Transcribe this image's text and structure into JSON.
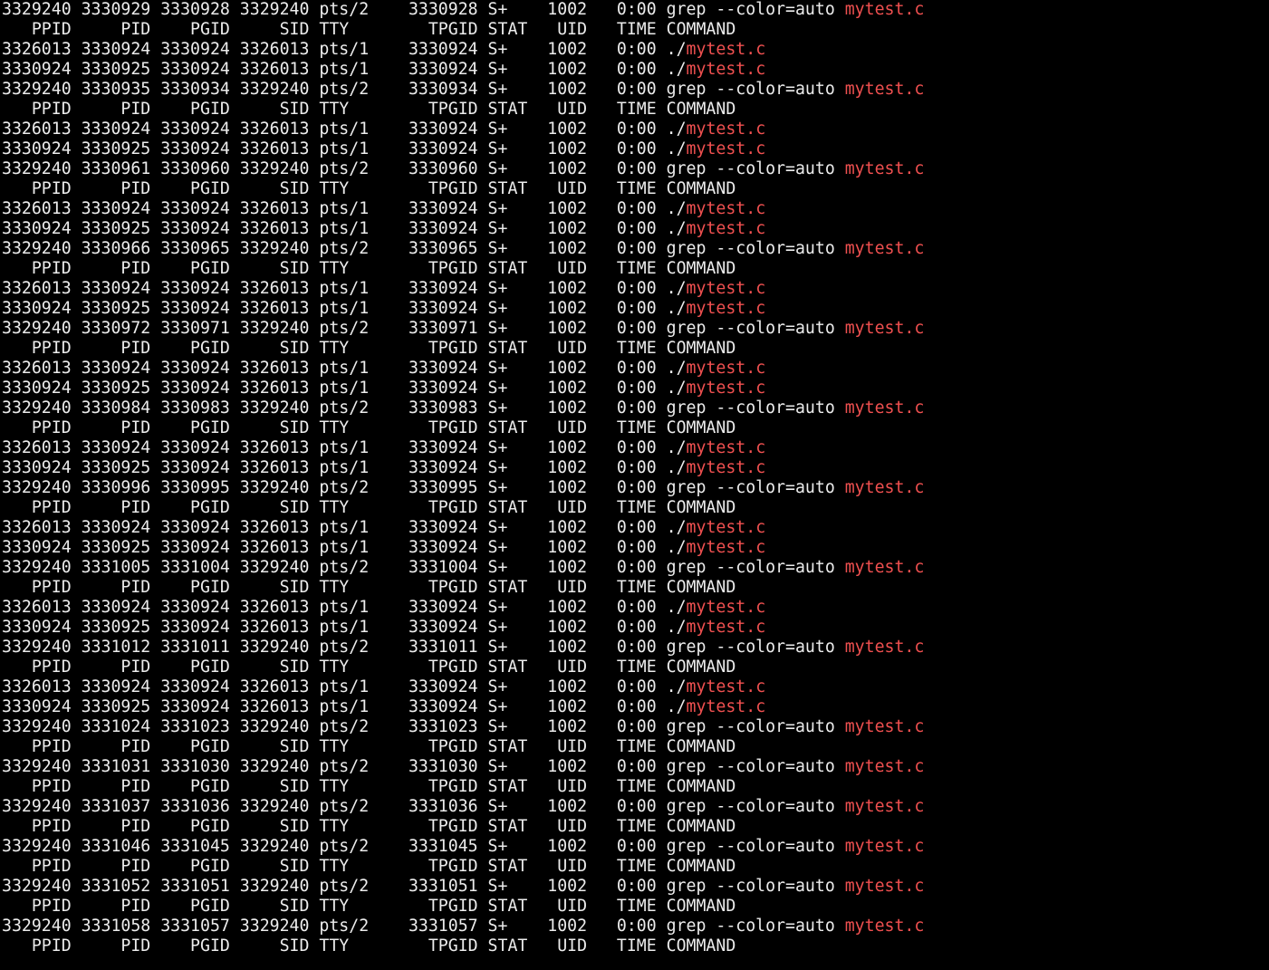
{
  "terminal": {
    "colors": {
      "background": "#000000",
      "foreground": "#ececec",
      "match_highlight": "#f05050"
    },
    "lines": [
      {
        "pre": "3329240 3330929 3330928 3329240 pts/2    3330928 S+    1002   0:00 grep --color=auto ",
        "match": "mytest.c"
      },
      {
        "pre": "   PPID     PID    PGID     SID TTY        TPGID STAT   UID   TIME COMMAND",
        "match": ""
      },
      {
        "pre": "3326013 3330924 3330924 3326013 pts/1    3330924 S+    1002   0:00 ./",
        "match": "mytest.c"
      },
      {
        "pre": "3330924 3330925 3330924 3326013 pts/1    3330924 S+    1002   0:00 ./",
        "match": "mytest.c"
      },
      {
        "pre": "3329240 3330935 3330934 3329240 pts/2    3330934 S+    1002   0:00 grep --color=auto ",
        "match": "mytest.c"
      },
      {
        "pre": "   PPID     PID    PGID     SID TTY        TPGID STAT   UID   TIME COMMAND",
        "match": ""
      },
      {
        "pre": "3326013 3330924 3330924 3326013 pts/1    3330924 S+    1002   0:00 ./",
        "match": "mytest.c"
      },
      {
        "pre": "3330924 3330925 3330924 3326013 pts/1    3330924 S+    1002   0:00 ./",
        "match": "mytest.c"
      },
      {
        "pre": "3329240 3330961 3330960 3329240 pts/2    3330960 S+    1002   0:00 grep --color=auto ",
        "match": "mytest.c"
      },
      {
        "pre": "   PPID     PID    PGID     SID TTY        TPGID STAT   UID   TIME COMMAND",
        "match": ""
      },
      {
        "pre": "3326013 3330924 3330924 3326013 pts/1    3330924 S+    1002   0:00 ./",
        "match": "mytest.c"
      },
      {
        "pre": "3330924 3330925 3330924 3326013 pts/1    3330924 S+    1002   0:00 ./",
        "match": "mytest.c"
      },
      {
        "pre": "3329240 3330966 3330965 3329240 pts/2    3330965 S+    1002   0:00 grep --color=auto ",
        "match": "mytest.c"
      },
      {
        "pre": "   PPID     PID    PGID     SID TTY        TPGID STAT   UID   TIME COMMAND",
        "match": ""
      },
      {
        "pre": "3326013 3330924 3330924 3326013 pts/1    3330924 S+    1002   0:00 ./",
        "match": "mytest.c"
      },
      {
        "pre": "3330924 3330925 3330924 3326013 pts/1    3330924 S+    1002   0:00 ./",
        "match": "mytest.c"
      },
      {
        "pre": "3329240 3330972 3330971 3329240 pts/2    3330971 S+    1002   0:00 grep --color=auto ",
        "match": "mytest.c"
      },
      {
        "pre": "   PPID     PID    PGID     SID TTY        TPGID STAT   UID   TIME COMMAND",
        "match": ""
      },
      {
        "pre": "3326013 3330924 3330924 3326013 pts/1    3330924 S+    1002   0:00 ./",
        "match": "mytest.c"
      },
      {
        "pre": "3330924 3330925 3330924 3326013 pts/1    3330924 S+    1002   0:00 ./",
        "match": "mytest.c"
      },
      {
        "pre": "3329240 3330984 3330983 3329240 pts/2    3330983 S+    1002   0:00 grep --color=auto ",
        "match": "mytest.c"
      },
      {
        "pre": "   PPID     PID    PGID     SID TTY        TPGID STAT   UID   TIME COMMAND",
        "match": ""
      },
      {
        "pre": "3326013 3330924 3330924 3326013 pts/1    3330924 S+    1002   0:00 ./",
        "match": "mytest.c"
      },
      {
        "pre": "3330924 3330925 3330924 3326013 pts/1    3330924 S+    1002   0:00 ./",
        "match": "mytest.c"
      },
      {
        "pre": "3329240 3330996 3330995 3329240 pts/2    3330995 S+    1002   0:00 grep --color=auto ",
        "match": "mytest.c"
      },
      {
        "pre": "   PPID     PID    PGID     SID TTY        TPGID STAT   UID   TIME COMMAND",
        "match": ""
      },
      {
        "pre": "3326013 3330924 3330924 3326013 pts/1    3330924 S+    1002   0:00 ./",
        "match": "mytest.c"
      },
      {
        "pre": "3330924 3330925 3330924 3326013 pts/1    3330924 S+    1002   0:00 ./",
        "match": "mytest.c"
      },
      {
        "pre": "3329240 3331005 3331004 3329240 pts/2    3331004 S+    1002   0:00 grep --color=auto ",
        "match": "mytest.c"
      },
      {
        "pre": "   PPID     PID    PGID     SID TTY        TPGID STAT   UID   TIME COMMAND",
        "match": ""
      },
      {
        "pre": "3326013 3330924 3330924 3326013 pts/1    3330924 S+    1002   0:00 ./",
        "match": "mytest.c"
      },
      {
        "pre": "3330924 3330925 3330924 3326013 pts/1    3330924 S+    1002   0:00 ./",
        "match": "mytest.c"
      },
      {
        "pre": "3329240 3331012 3331011 3329240 pts/2    3331011 S+    1002   0:00 grep --color=auto ",
        "match": "mytest.c"
      },
      {
        "pre": "   PPID     PID    PGID     SID TTY        TPGID STAT   UID   TIME COMMAND",
        "match": ""
      },
      {
        "pre": "3326013 3330924 3330924 3326013 pts/1    3330924 S+    1002   0:00 ./",
        "match": "mytest.c"
      },
      {
        "pre": "3330924 3330925 3330924 3326013 pts/1    3330924 S+    1002   0:00 ./",
        "match": "mytest.c"
      },
      {
        "pre": "3329240 3331024 3331023 3329240 pts/2    3331023 S+    1002   0:00 grep --color=auto ",
        "match": "mytest.c"
      },
      {
        "pre": "   PPID     PID    PGID     SID TTY        TPGID STAT   UID   TIME COMMAND",
        "match": ""
      },
      {
        "pre": "3329240 3331031 3331030 3329240 pts/2    3331030 S+    1002   0:00 grep --color=auto ",
        "match": "mytest.c"
      },
      {
        "pre": "   PPID     PID    PGID     SID TTY        TPGID STAT   UID   TIME COMMAND",
        "match": ""
      },
      {
        "pre": "3329240 3331037 3331036 3329240 pts/2    3331036 S+    1002   0:00 grep --color=auto ",
        "match": "mytest.c"
      },
      {
        "pre": "   PPID     PID    PGID     SID TTY        TPGID STAT   UID   TIME COMMAND",
        "match": ""
      },
      {
        "pre": "3329240 3331046 3331045 3329240 pts/2    3331045 S+    1002   0:00 grep --color=auto ",
        "match": "mytest.c"
      },
      {
        "pre": "   PPID     PID    PGID     SID TTY        TPGID STAT   UID   TIME COMMAND",
        "match": ""
      },
      {
        "pre": "3329240 3331052 3331051 3329240 pts/2    3331051 S+    1002   0:00 grep --color=auto ",
        "match": "mytest.c"
      },
      {
        "pre": "   PPID     PID    PGID     SID TTY        TPGID STAT   UID   TIME COMMAND",
        "match": ""
      },
      {
        "pre": "3329240 3331058 3331057 3329240 pts/2    3331057 S+    1002   0:00 grep --color=auto ",
        "match": "mytest.c"
      },
      {
        "pre": "   PPID     PID    PGID     SID TTY        TPGID STAT   UID   TIME COMMAND",
        "match": ""
      }
    ]
  }
}
